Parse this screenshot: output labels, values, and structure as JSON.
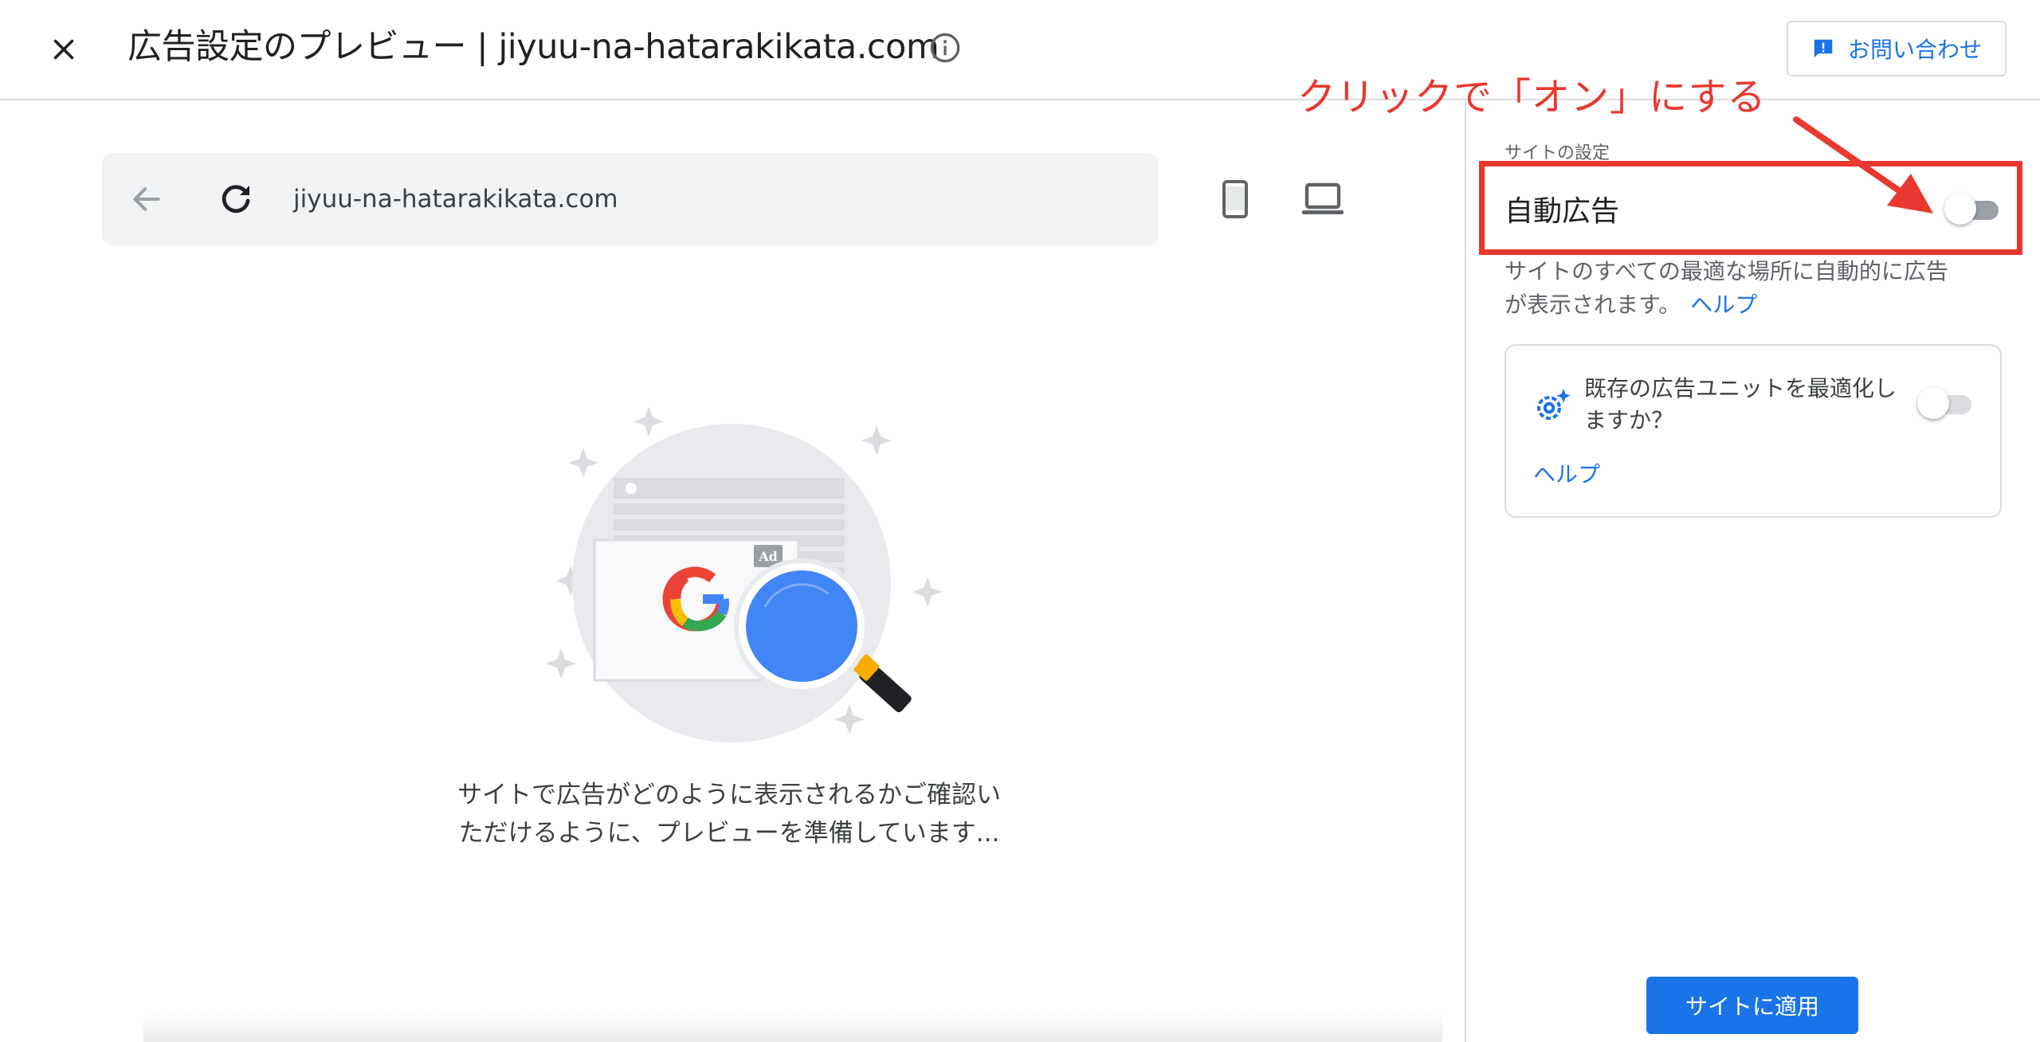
{
  "header": {
    "title": "広告設定のプレビュー | jiyuu-na-hatarakikata.com",
    "contact_label": "お問い合わせ"
  },
  "preview": {
    "url": "jiyuu-na-hatarakikata.com",
    "ad_badge": "Ad",
    "loading_message": "サイトで広告がどのように表示されるかご確認いただけるように、プレビューを準備しています..."
  },
  "settings": {
    "section_label": "サイトの設定",
    "auto_ads": {
      "title": "自動広告",
      "enabled": false,
      "description": "サイトのすべての最適な場所に自動的に広告が表示されます。",
      "help_label": "ヘルプ"
    },
    "optimize_units": {
      "text": "既存の広告ユニットを最適化しますか？",
      "enabled": false,
      "help_label": "ヘルプ"
    },
    "apply_label": "サイトに適用"
  },
  "annotation": {
    "text": "クリックで「オン」にする",
    "color": "#e8382f"
  },
  "colors": {
    "accent": "#1a73e8",
    "toggle_off_track": "#9aa0a6"
  }
}
